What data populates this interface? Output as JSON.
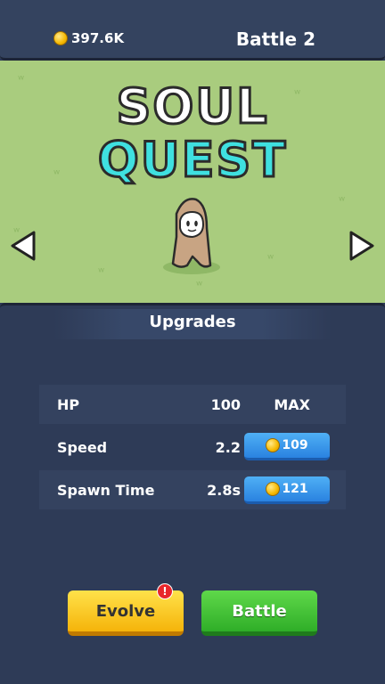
{
  "header": {
    "coins": "397.6K",
    "battle_label": "Battle 2"
  },
  "title": {
    "line1": "SOUL",
    "line2": "QUEST"
  },
  "upgrades": {
    "title": "Upgrades",
    "rows": [
      {
        "label": "HP",
        "value": "100",
        "status": "MAX"
      },
      {
        "label": "Speed",
        "value": "2.2",
        "cost": "109"
      },
      {
        "label": "Spawn Time",
        "value": "2.8s",
        "cost": "121"
      }
    ]
  },
  "buttons": {
    "evolve": "Evolve",
    "battle": "Battle",
    "evolve_alert": "!"
  },
  "icons": {
    "coin": "coin-icon",
    "left": "arrow-left-icon",
    "right": "arrow-right-icon"
  },
  "colors": {
    "upgrade_button": "#2a82e0",
    "evolve_button": "#f5b40a",
    "battle_button": "#2fae28",
    "title_quest": "#3fe0e0"
  }
}
